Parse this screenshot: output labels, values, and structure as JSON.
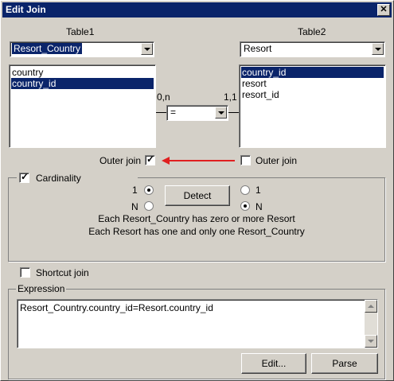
{
  "window": {
    "title": "Edit Join",
    "close_glyph": "✕"
  },
  "table1": {
    "label": "Table1",
    "selected": "Resort_Country",
    "columns": [
      "country",
      "country_id"
    ],
    "selected_column_index": 1
  },
  "table2": {
    "label": "Table2",
    "selected": "Resort",
    "columns": [
      "country_id",
      "resort",
      "resort_id"
    ],
    "selected_column_index": 0
  },
  "join": {
    "left_cardinality": "0,n",
    "right_cardinality": "1,1",
    "operator": "="
  },
  "outer_join_left": {
    "label": "Outer join",
    "checked": true
  },
  "outer_join_right": {
    "label": "Outer join",
    "checked": false
  },
  "cardinality": {
    "label": "Cardinality",
    "checked": true,
    "left_one": "1",
    "left_n": "N",
    "right_one": "1",
    "right_n": "N",
    "detect_label": "Detect",
    "description_1": "Each Resort_Country has zero or more Resort",
    "description_2": "Each Resort has one and only one Resort_Country"
  },
  "shortcut": {
    "label": "Shortcut join",
    "checked": false
  },
  "expression": {
    "label": "Expression",
    "value": "Resort_Country.country_id=Resort.country_id",
    "edit_label": "Edit...",
    "parse_label": "Parse"
  },
  "colors": {
    "titlebar": "#0a246a",
    "selection": "#0a246a",
    "arrow": "#e02020",
    "face": "#d4d0c8"
  }
}
